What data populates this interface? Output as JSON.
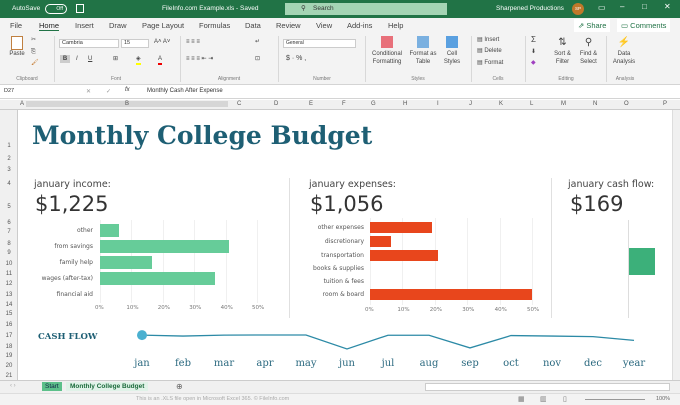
{
  "titlebar": {
    "autosave": "AutoSave",
    "autosave_state": "Off",
    "filename": "FileInfo.com Example.xls - Saved",
    "search": "Search",
    "user": "Sharpened Productions",
    "initials": "SP"
  },
  "menu": [
    "File",
    "Home",
    "Insert",
    "Draw",
    "Page Layout",
    "Formulas",
    "Data",
    "Review",
    "View",
    "Add-ins",
    "Help"
  ],
  "share": "Share",
  "comments": "Comments",
  "ribbon": {
    "paste": "Paste",
    "font": "Cambria",
    "size": "15",
    "number_format": "General",
    "cond_fmt": "Conditional Formatting",
    "fmt_table": "Format as Table",
    "cell_styles": "Cell Styles",
    "insert": "Insert",
    "delete": "Delete",
    "format": "Format",
    "sort": "Sort & Filter",
    "find": "Find & Select",
    "data_analysis": "Data Analysis",
    "groups": [
      "Clipboard",
      "Font",
      "Alignment",
      "Number",
      "Styles",
      "Cells",
      "Editing",
      "Analysis"
    ]
  },
  "formula": {
    "cell": "D27",
    "fx": "fx",
    "value": "Monthly Cash After Expense"
  },
  "columns": [
    "A",
    "B",
    "C",
    "D",
    "E",
    "F",
    "G",
    "H",
    "I",
    "J",
    "K",
    "L",
    "M",
    "N",
    "O",
    "P"
  ],
  "rows": [
    "1",
    "2",
    "3",
    "4",
    "5",
    "6",
    "7",
    "8",
    "9",
    "10",
    "11",
    "12",
    "13",
    "14",
    "15",
    "16",
    "17",
    "18",
    "19",
    "20",
    "21"
  ],
  "sheet": {
    "title": "Monthly College Budget",
    "income": {
      "label": "january income:",
      "value": "$1,225"
    },
    "expenses": {
      "label": "january expenses:",
      "value": "$1,056"
    },
    "cashflow": {
      "label": "january cash flow:",
      "value": "$169"
    },
    "cashflow_title": "CASH FLOW"
  },
  "chart_data": [
    {
      "type": "bar",
      "title": "january income",
      "orientation": "horizontal",
      "categories": [
        "other",
        "from savings",
        "family help",
        "wages (after-tax)",
        "financial aid"
      ],
      "values": [
        6,
        41,
        16.5,
        36.5,
        0
      ],
      "xlim": [
        0,
        50
      ],
      "ticks": [
        "0%",
        "10%",
        "20%",
        "30%",
        "40%",
        "50%"
      ],
      "color": "#66cc99"
    },
    {
      "type": "bar",
      "title": "january expenses",
      "orientation": "horizontal",
      "categories": [
        "other expenses",
        "discretionary",
        "transportation",
        "books & supplies",
        "tuition & fees",
        "room & board"
      ],
      "values": [
        19,
        6.5,
        21,
        0,
        0,
        50
      ],
      "xlim": [
        0,
        50
      ],
      "ticks": [
        "0%",
        "10%",
        "20%",
        "30%",
        "40%",
        "50%"
      ],
      "color": "#e8461c"
    },
    {
      "type": "bar",
      "title": "january cash flow",
      "values": [
        169
      ],
      "color": "#3cb07a"
    },
    {
      "type": "line",
      "title": "CASH FLOW",
      "categories": [
        "jan",
        "feb",
        "mar",
        "apr",
        "may",
        "jun",
        "jul",
        "aug",
        "sep",
        "oct",
        "nov",
        "dec",
        "year"
      ],
      "values": [
        169,
        160,
        169,
        170,
        170,
        40,
        168,
        168,
        50,
        165,
        160,
        155,
        120
      ],
      "color": "#2c8aa6"
    }
  ],
  "tabs": [
    "Start",
    "Monthly College Budget"
  ],
  "status": {
    "text": "This is an .XLS file open in Microsoft Excel 365. © FileInfo.com",
    "zoom": "100%"
  }
}
